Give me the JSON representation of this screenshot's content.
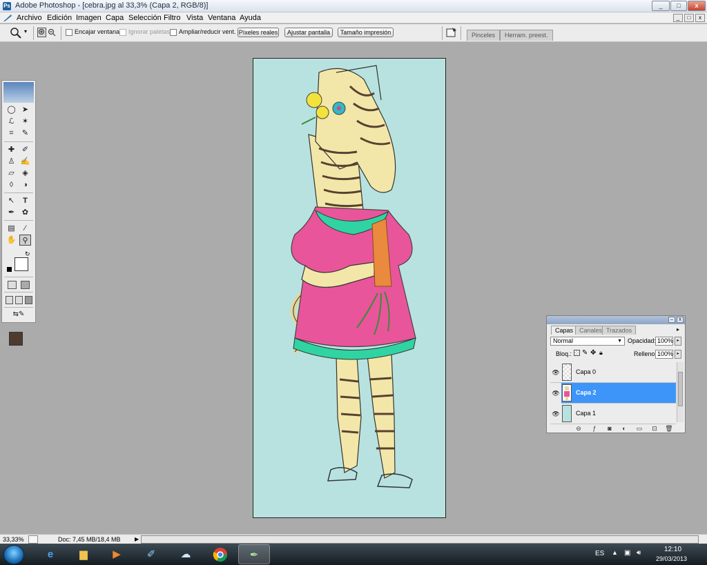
{
  "window": {
    "title": "Adobe Photoshop - [cebra.jpg al 33,3% (Capa 2, RGB/8)]",
    "app_icon": "Ps",
    "controls": [
      "_",
      "□",
      "x"
    ]
  },
  "menu": {
    "items": [
      "Archivo",
      "Edición",
      "Imagen",
      "Capa",
      "Selección",
      "Filtro",
      "Vista",
      "Ventana",
      "Ayuda"
    ],
    "doc_controls": [
      "_",
      "□",
      "x"
    ]
  },
  "options_bar": {
    "checks": [
      {
        "label": "Encajar ventana",
        "enabled": true
      },
      {
        "label": "Ignorar paletas",
        "enabled": false
      },
      {
        "label": "Ampliar/reducir vent.",
        "enabled": true
      }
    ],
    "buttons": [
      "Píxeles reales",
      "Ajustar pantalla",
      "Tamaño impresión"
    ],
    "palette_tabs": [
      "Pinceles",
      "Herram. preest."
    ]
  },
  "tools": {
    "foreground_color": "#4e3b30",
    "background_color": "#ffffff"
  },
  "layers_panel": {
    "tabs": [
      "Capas",
      "Canales",
      "Trazados"
    ],
    "active_tab": "Capas",
    "blend_mode": "Normal",
    "opacity_label": "Opacidad:",
    "opacity_value": "100%",
    "lock_label": "Bloq.:",
    "fill_label": "Relleno:",
    "fill_value": "100%",
    "layers": [
      {
        "name": "Capa 0",
        "visible": true,
        "selected": false,
        "thumb": "transparent"
      },
      {
        "name": "Capa 2",
        "visible": true,
        "selected": true,
        "thumb": "artwork"
      },
      {
        "name": "Capa 1",
        "visible": true,
        "selected": false,
        "thumb": "#b8e2df"
      }
    ],
    "selected_color": "#3d95fa"
  },
  "canvas": {
    "background_color": "#b8e2df",
    "zebra_fill": "#f2e7a8",
    "dress_color": "#e8559a",
    "trim_color": "#2fd4a2",
    "carrot_color": "#e98a3e",
    "stripe_color": "#5a4030"
  },
  "status_bar": {
    "zoom": "33,33%",
    "doc_info": "Doc: 7,45 MB/18,4 MB"
  },
  "taskbar": {
    "language": "ES",
    "time": "12:10",
    "date": "29/03/2013"
  }
}
